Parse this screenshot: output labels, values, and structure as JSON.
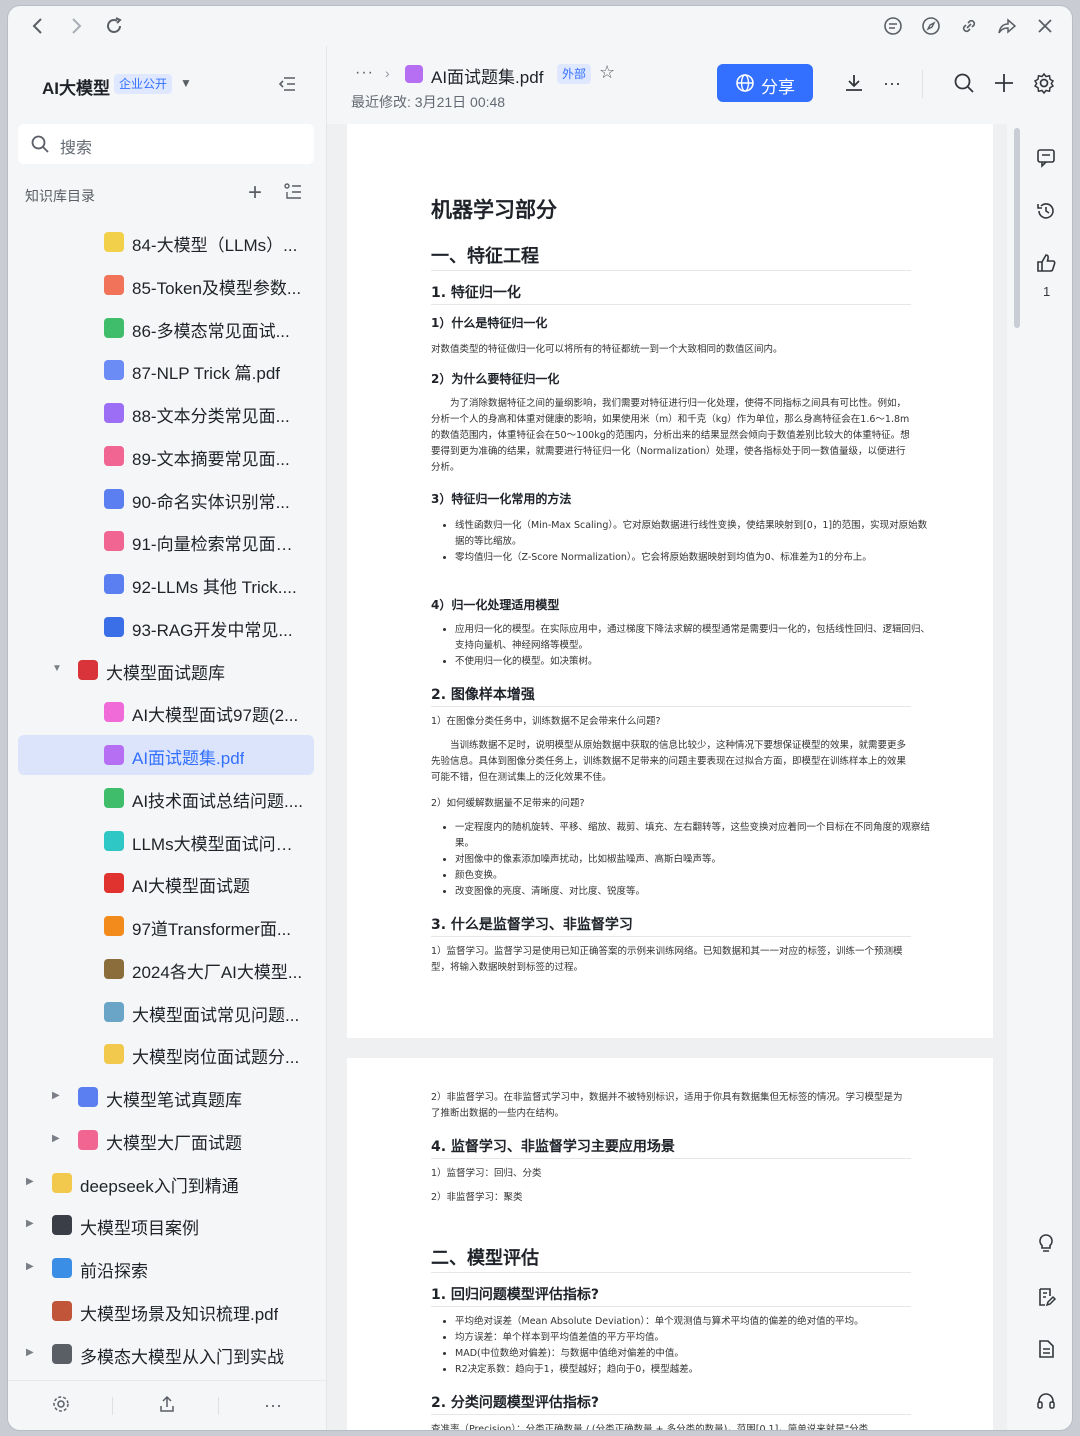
{
  "sidebar": {
    "workspace_title": "AI大模型",
    "workspace_badge": "企业公开",
    "search_placeholder": "搜索",
    "kb_label": "知识库目录",
    "items": [
      {
        "label": "84-大模型（LLMs）...",
        "icon": "bulb-icon",
        "color": "#f2d04a"
      },
      {
        "label": "85-Token及模型参数...",
        "icon": "doc-icon",
        "color": "#f0735a"
      },
      {
        "label": "86-多模态常见面试...",
        "icon": "doc-icon",
        "color": "#3fbd6a"
      },
      {
        "label": "87-NLP Trick 篇.pdf",
        "icon": "doc-icon",
        "color": "#6b8cf5"
      },
      {
        "label": "88-文本分类常见面...",
        "icon": "doc-icon",
        "color": "#9b6ef5"
      },
      {
        "label": "89-文本摘要常见面...",
        "icon": "doc-icon",
        "color": "#f06591"
      },
      {
        "label": "90-命名实体识别常...",
        "icon": "doc-icon",
        "color": "#5b7ef0"
      },
      {
        "label": "91-向量检索常见面试...",
        "icon": "doc-icon",
        "color": "#f06591"
      },
      {
        "label": "92-LLMs 其他 Trick....",
        "icon": "doc-icon",
        "color": "#5b7ef0"
      },
      {
        "label": "93-RAG开发中常见...",
        "icon": "doc-icon",
        "color": "#3a6fe8"
      },
      {
        "label": "大模型面试题库",
        "icon": "book-icon",
        "color": "#d9343a"
      },
      {
        "label": "AI大模型面试97题(2...",
        "icon": "doc-icon",
        "color": "#f06ad8"
      },
      {
        "label": "AI面试题集.pdf",
        "icon": "pdf-icon",
        "color": "#b66ff2"
      },
      {
        "label": "AI技术面试总结问题....",
        "icon": "doc-icon",
        "color": "#3fbd6a"
      },
      {
        "label": "LLMs大模型面试问题...",
        "icon": "doc-icon",
        "color": "#2fc6c6"
      },
      {
        "label": "AI大模型面试题",
        "icon": "magnet-icon",
        "color": "#e0322e"
      },
      {
        "label": "97道Transformer面...",
        "icon": "pumpkin-icon",
        "color": "#f28b1c"
      },
      {
        "label": "2024各大厂AI大模型...",
        "icon": "ladder-icon",
        "color": "#8a6d3b"
      },
      {
        "label": "大模型面试常见问题...",
        "icon": "snow-icon",
        "color": "#6aa5c8"
      },
      {
        "label": "大模型岗位面试题分...",
        "icon": "folder-icon",
        "color": "#f2c94c"
      },
      {
        "label": "大模型笔试真题库",
        "icon": "globe-icon",
        "color": "#5b7ef0"
      },
      {
        "label": "大模型大厂面试题",
        "icon": "doc-icon",
        "color": "#f06591"
      },
      {
        "label": "deepseek入门到精通",
        "icon": "folder-icon",
        "color": "#f2c94c"
      },
      {
        "label": "大模型项目案例",
        "icon": "laptop-icon",
        "color": "#3a3f47"
      },
      {
        "label": "前沿探索",
        "icon": "earth-icon",
        "color": "#3a8ee6"
      },
      {
        "label": "大模型场景及知识梳理.pdf",
        "icon": "books-icon",
        "color": "#c0553a"
      },
      {
        "label": "多模态大模型从入门到实战",
        "icon": "magnifier-icon",
        "color": "#5a5f66"
      }
    ]
  },
  "header": {
    "breadcrumb_more": "···",
    "doc_title": "AI面试题集.pdf",
    "external_badge": "外部",
    "modified": "最近修改: 3月21日 00:48",
    "share_label": "分享",
    "accent": "#3370ff"
  },
  "rail": {
    "like_count": "1"
  },
  "doc": {
    "title": "机器学习部分",
    "sec1": "一、特征工程",
    "s1": "1. 特征归一化",
    "q1": "1）什么是特征归一化",
    "q1_text": "对数值类型的特征做归一化可以将所有的特征都统一到一个大致相同的数值区间内。",
    "q2": "2）为什么要特征归一化",
    "q2_text": "为了消除数据特征之间的量纲影响，我们需要对特征进行归一化处理，使得不同指标之间具有可比性。例如，分析一个人的身高和体重对健康的影响，如果使用米（m）和千克（kg）作为单位，那么身高特征会在1.6～1.8m的数值范围内，体重特征会在50～100kg的范围内，分析出来的结果显然会倾向于数值差别比较大的体重特征。想要得到更为准确的结果，就需要进行特征归一化（Normalization）处理，使各指标处于同一数值量级，以便进行分析。",
    "q3": "3）特征归一化常用的方法",
    "q3_items": [
      "线性函数归一化（Min-Max Scaling）。它对原始数据进行线性变换，使结果映射到[0，1]的范围，实现对原始数据的等比缩放。",
      "零均值归一化（Z-Score Normalization）。它会将原始数据映射到均值为0、标准差为1的分布上。"
    ],
    "q4": "4）归一化处理适用模型",
    "q4_items": [
      "应用归一化的模型。在实际应用中，通过梯度下降法求解的模型通常是需要归一化的，包括线性回归、逻辑回归、支持向量机、神经网络等模型。",
      "不使用归一化的模型。如决策树。"
    ],
    "s2": "2. 图像样本增强",
    "s2_q1": "1）在图像分类任务中，训练数据不足会带来什么问题?",
    "s2_q1_text": "当训练数据不足时，说明模型从原始数据中获取的信息比较少，这种情况下要想保证模型的效果，就需要更多先验信息。具体到图像分类任务上，训练数据不足带来的问题主要表现在过拟合方面，即模型在训练样本上的效果可能不错，但在测试集上的泛化效果不佳。",
    "s2_q2": "2）如何缓解数据量不足带来的问题?",
    "s2_items": [
      "一定程度内的随机旋转、平移、缩放、裁剪、填充、左右翻转等，这些变换对应着同一个目标在不同角度的观察结果。",
      "对图像中的像素添加噪声扰动，比如椒盐噪声、高斯白噪声等。",
      "颜色变换。",
      "改变图像的亮度、清晰度、对比度、锐度等。"
    ],
    "s3": "3. 什么是监督学习、非监督学习",
    "s3_text": "1）监督学习。监督学习是使用已知正确答案的示例来训练网络。已知数据和其一一对应的标签，训练一个预测模型，将输入数据映射到标签的过程。",
    "p2_text": "2）非监督学习。在非监督式学习中，数据并不被特别标识，适用于你具有数据集但无标签的情况。学习模型是为了推断出数据的一些内在结构。",
    "s4": "4. 监督学习、非监督学习主要应用场景",
    "s4_l1": "1）监督学习：回归、分类",
    "s4_l2": "2）非监督学习：聚类",
    "sec2": "二、模型评估",
    "e1": "1. 回归问题模型评估指标?",
    "e1_items": [
      "平均绝对误差（Mean Absolute Deviation）：单个观测值与算术平均值的偏差的绝对值的平均。",
      "均方误差：单个样本到平均值差值的平方平均值。",
      "MAD(中位数绝对偏差)：与数据中值绝对偏差的中值。",
      "R2决定系数：趋向于1，模型越好；趋向于0，模型越差。"
    ],
    "e2": "2. 分类问题模型评估指标?",
    "e2_text": "查准率（Precision）：分类正确数量 / (分类正确数量 + 多分类的数量)，范围[0,1]，简单说来就是\"分类"
  }
}
